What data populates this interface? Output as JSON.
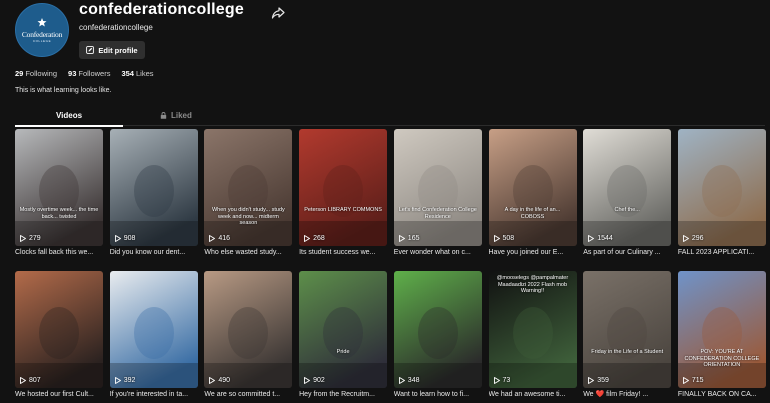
{
  "profile": {
    "username": "confederationcollege",
    "nickname": "confederationcollege",
    "avatar_text": "Confederation",
    "avatar_sub": "COLLEGE",
    "edit_label": "Edit profile",
    "bio": "This is what learning looks like."
  },
  "stats": {
    "following_count": "29",
    "following_label": "Following",
    "followers_count": "93",
    "followers_label": "Followers",
    "likes_count": "354",
    "likes_label": "Likes"
  },
  "tabs": {
    "videos": "Videos",
    "liked": "Liked"
  },
  "icons": {
    "share": "share-icon",
    "edit": "edit-icon",
    "lock": "lock-icon",
    "play": "play-icon"
  },
  "videos": [
    {
      "views": "279",
      "caption": "Clocks fall back this we...",
      "overlay": "Mostly overtime week... the time back... twisted",
      "palette": [
        "#b7b9bb",
        "#3c3535"
      ]
    },
    {
      "views": "908",
      "caption": "Did you know our dent...",
      "overlay": "",
      "palette": [
        "#a7b0b6",
        "#2f3a44"
      ]
    },
    {
      "views": "416",
      "caption": "Who else wasted study...",
      "overlay": "When you didn't study... study week and now... midterm season",
      "palette": [
        "#8b7569",
        "#4a3a33"
      ]
    },
    {
      "views": "268",
      "caption": "Its student success we...",
      "overlay": "Peterson LIBRARY COMMONS",
      "palette": [
        "#b23a2e",
        "#5e1f1a"
      ]
    },
    {
      "views": "165",
      "caption": "Ever wonder what on c...",
      "overlay": "Let's find Confederation College Residence",
      "palette": [
        "#cfc9c0",
        "#8f8a84"
      ]
    },
    {
      "views": "508",
      "caption": "Have you joined our E...",
      "overlay": "A day in the life of an... COBOSS",
      "palette": [
        "#c79f86",
        "#4d3b33"
      ]
    },
    {
      "views": "1544",
      "caption": "As part of our Culinary ...",
      "overlay": "Chef the...",
      "palette": [
        "#e0ddd6",
        "#6a6a66"
      ]
    },
    {
      "views": "296",
      "caption": "FALL 2023 APPLICATI...",
      "overlay": "",
      "palette": [
        "#9fb3c4",
        "#8e6e50"
      ]
    },
    {
      "views": "807",
      "caption": "We hosted our first Cult...",
      "overlay": "",
      "palette": [
        "#b36b4a",
        "#2b2220"
      ]
    },
    {
      "views": "392",
      "caption": "If you're interested in ta...",
      "overlay": "",
      "palette": [
        "#e9ecef",
        "#3a6ea5"
      ]
    },
    {
      "views": "490",
      "caption": "We are so committed t...",
      "overlay": "",
      "palette": [
        "#b89a84",
        "#3b3634"
      ]
    },
    {
      "views": "902",
      "caption": "Hey from the Recruitm...",
      "overlay": "Pride",
      "palette": [
        "#5d8f4a",
        "#2f2f3a"
      ]
    },
    {
      "views": "348",
      "caption": "Want to learn how to fi...",
      "overlay": "",
      "palette": [
        "#5fb04a",
        "#2b2b2b"
      ]
    },
    {
      "views": "73",
      "caption": "We had an awesome ti...",
      "overlay": "@mooselegs @pampalmater Maadaadizi 2022 Flash mob Warning!!",
      "palette": [
        "#111111",
        "#3e5f3a"
      ]
    },
    {
      "views": "359",
      "caption": "We ❤️ film Friday! ...",
      "overlay": "Friday in the Life of a Student",
      "palette": [
        "#7a7168",
        "#4c4640"
      ]
    },
    {
      "views": "715",
      "caption": "FINALLY BACK ON CA...",
      "overlay": "POV: YOU'RE AT CONFEDERATION COLLEGE ORIENTATION",
      "palette": [
        "#6f93c9",
        "#9a5a3a"
      ]
    }
  ]
}
